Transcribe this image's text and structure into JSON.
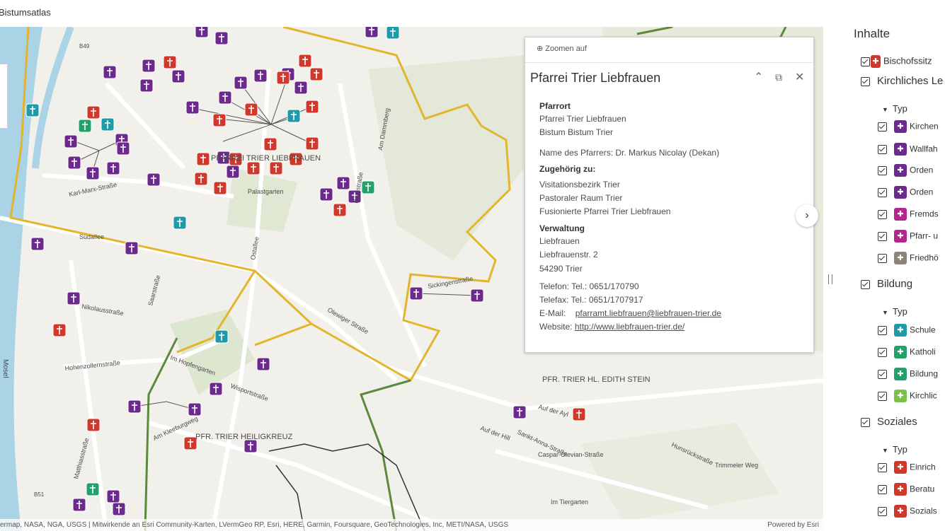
{
  "app": {
    "title": "Bistumsatlas"
  },
  "map": {
    "labels": [
      {
        "text": "PFARREI TRIER LIEBFRAUEN"
      },
      {
        "text": "PFR. TRIER HL. EDITH STEIN"
      },
      {
        "text": "PFR. TRIER HEILIGKREUZ"
      },
      {
        "text": "Ostallee"
      },
      {
        "text": "Südallee"
      },
      {
        "text": "Palastgarten"
      },
      {
        "text": "Olewiger Straße"
      },
      {
        "text": "Hohenzollernstraße"
      },
      {
        "text": "Karl-Marx-Straße"
      },
      {
        "text": "Saarstraße"
      },
      {
        "text": "Bergstraße"
      },
      {
        "text": "Am Dammberg"
      },
      {
        "text": "Sickingenstraße"
      },
      {
        "text": "Im Hopfengarten"
      },
      {
        "text": "Wisportstraße"
      },
      {
        "text": "Am Kleeburgweg"
      },
      {
        "text": "Auf der Ayl"
      },
      {
        "text": "Caspar-Olevian-Straße"
      },
      {
        "text": "Trimmeler Weg"
      },
      {
        "text": "Im Tiergarten"
      },
      {
        "text": "Mosel"
      },
      {
        "text": "B49"
      },
      {
        "text": "B51"
      },
      {
        "text": "Nikolausstraße"
      },
      {
        "text": "Matthiasstraße"
      },
      {
        "text": "Auf der Hill"
      },
      {
        "text": "Sankt-Anna-Straße"
      },
      {
        "text": "Hunsrückstraße"
      }
    ],
    "attribution": "ermap, NASA, NGA, USGS | Mitwirkende an Esri Community-Karten, LVermGeo RP, Esri, HERE, Garmin, Foursquare, GeoTechnologies, Inc, METI/NASA, USGS",
    "powered": "Powered by Esri",
    "colors": {
      "purple": "#6b2a8c",
      "red": "#d0382b",
      "teal": "#1e9aa8",
      "green": "#24a06b",
      "boundary": "#e3b52c",
      "road": "#ffffff",
      "park": "#dfe8cf",
      "river": "#aad3e6"
    }
  },
  "popup": {
    "zoom_label": "Zoomen auf",
    "title": "Pfarrei Trier Liebfrauen",
    "sections": {
      "pfarrort_h": "Pfarrort",
      "pfarrort_1": "Pfarrei Trier Liebfrauen",
      "pfarrort_2": "Bistum Bistum Trier",
      "pfarrer": "Name des Pfarrers: Dr. Markus Nicolay (Dekan)",
      "zug_h": "Zugehörig zu:",
      "zug_1": "Visitationsbezirk Trier",
      "zug_2": "Pastoraler Raum Trier",
      "zug_3": "Fusionierte Pfarrei Trier Liebfrauen",
      "verw_h": "Verwaltung",
      "verw_1": "Liebfrauen",
      "verw_2": "Liebfrauenstr. 2",
      "verw_3": "54290 Trier",
      "tel": "Telefon:  Tel.: 0651/170790",
      "fax": "Telefax:  Tel.: 0651/1707917",
      "mail_label": "E-Mail:",
      "mail": "pfarramt.liebfrauen@liebfrauen-trier.de",
      "web_label": "Website:",
      "web": "http://www.liebfrauen-trier.de/"
    }
  },
  "panel": {
    "title": "Inhalte",
    "items": [
      {
        "label": "Bischofssitz",
        "kind": "layer",
        "color": "#d0382b"
      },
      {
        "label": "Kirchliches Le",
        "kind": "group"
      },
      {
        "label": "Typ",
        "kind": "typ"
      },
      {
        "label": "Kirchen",
        "kind": "item",
        "color": "#6b2a8c"
      },
      {
        "label": "Wallfah",
        "kind": "item",
        "color": "#6b2a8c"
      },
      {
        "label": "Orden",
        "kind": "item",
        "color": "#6b2a8c"
      },
      {
        "label": "Orden",
        "kind": "item",
        "color": "#6b2a8c"
      },
      {
        "label": "Fremds",
        "kind": "item",
        "color": "#b5268c"
      },
      {
        "label": "Pfarr- u",
        "kind": "item",
        "color": "#b5268c"
      },
      {
        "label": "Friedhö",
        "kind": "item",
        "color": "#8c8478"
      },
      {
        "label": "Bildung",
        "kind": "group"
      },
      {
        "label": "Typ",
        "kind": "typ"
      },
      {
        "label": "Schule",
        "kind": "item",
        "color": "#1e9aa8"
      },
      {
        "label": "Katholi",
        "kind": "item",
        "color": "#24a06b"
      },
      {
        "label": "Bildung",
        "kind": "item",
        "color": "#24a06b"
      },
      {
        "label": "Kirchlic",
        "kind": "item",
        "color": "#7cc04a"
      },
      {
        "label": "Soziales",
        "kind": "group"
      },
      {
        "label": "Typ",
        "kind": "typ"
      },
      {
        "label": "Einrich",
        "kind": "item",
        "color": "#d0382b"
      },
      {
        "label": "Beratu",
        "kind": "item",
        "color": "#d0382b"
      },
      {
        "label": "Sozials",
        "kind": "item",
        "color": "#d0382b"
      }
    ]
  }
}
